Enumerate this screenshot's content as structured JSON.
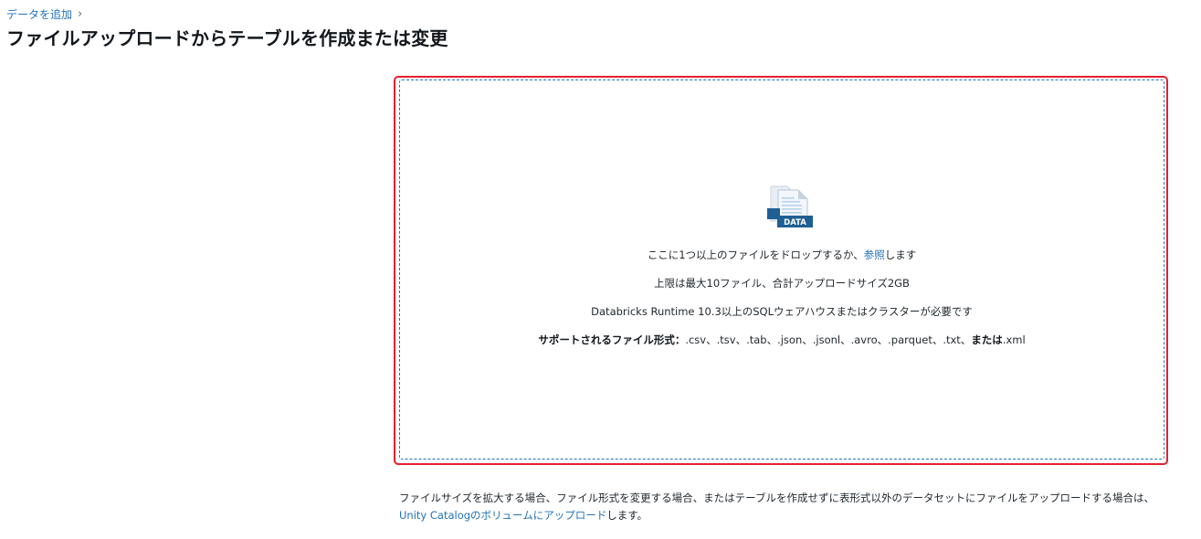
{
  "breadcrumb": {
    "link": "データを追加",
    "separator": "›"
  },
  "title": "ファイルアップロードからテーブルを作成または変更",
  "dropzone": {
    "icon_label": "DATA",
    "icon": "data-file-icon",
    "line1_prefix": "ここに1つ以上のファイルをドロップするか、",
    "line1_link": "参照",
    "line1_suffix": "します",
    "line2": "上限は最大10ファイル、合計アップロードサイズ2GB",
    "line3": "Databricks Runtime 10.3以上のSQLウェアハウスまたはクラスターが必要です",
    "formats_label": "サポートされるファイル形式：",
    "formats_list": ".csv、.tsv、.tab、.json、.jsonl、.avro、.parquet、.txt、",
    "formats_or": "または",
    "formats_last": ".xml"
  },
  "footnote": {
    "text": "ファイルサイズを拡大する場合、ファイル形式を変更する場合、またはテーブルを作成せずに表形式以外のデータセットにファイルをアップロードする場合は、",
    "link": "Unity Catalogのボリュームにアップロード",
    "suffix": "します。"
  },
  "colors": {
    "link": "#2272b4",
    "highlight_border": "#e5202e",
    "icon_badge": "#1f5f94"
  }
}
